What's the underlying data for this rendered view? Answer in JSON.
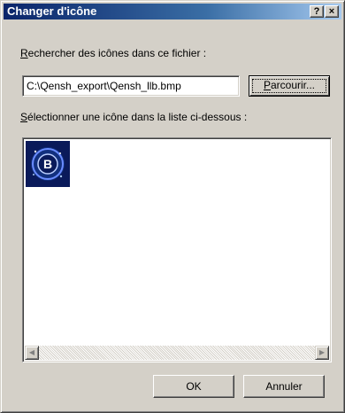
{
  "window": {
    "title": "Changer d'icône",
    "help_glyph": "?",
    "close_glyph": "×"
  },
  "search": {
    "label_mnemonic": "R",
    "label_rest": "echercher des icônes dans ce fichier :",
    "path_value": "C:\\Qensh_export\\Qensh_llb.bmp",
    "browse_mnemonic": "P",
    "browse_rest": "arcourir..."
  },
  "select": {
    "label_mnemonic": "S",
    "label_rest": "électionner une icône dans la liste ci-dessous :"
  },
  "icons": [
    {
      "name": "Qensh_llb",
      "glyph": "B",
      "colors": {
        "bg": "#0a1a5a",
        "ring": "#6a8cff",
        "core": "#ffffff"
      }
    }
  ],
  "scrollbar": {
    "left_glyph": "◀",
    "right_glyph": "▶"
  },
  "buttons": {
    "ok": "OK",
    "cancel": "Annuler"
  }
}
